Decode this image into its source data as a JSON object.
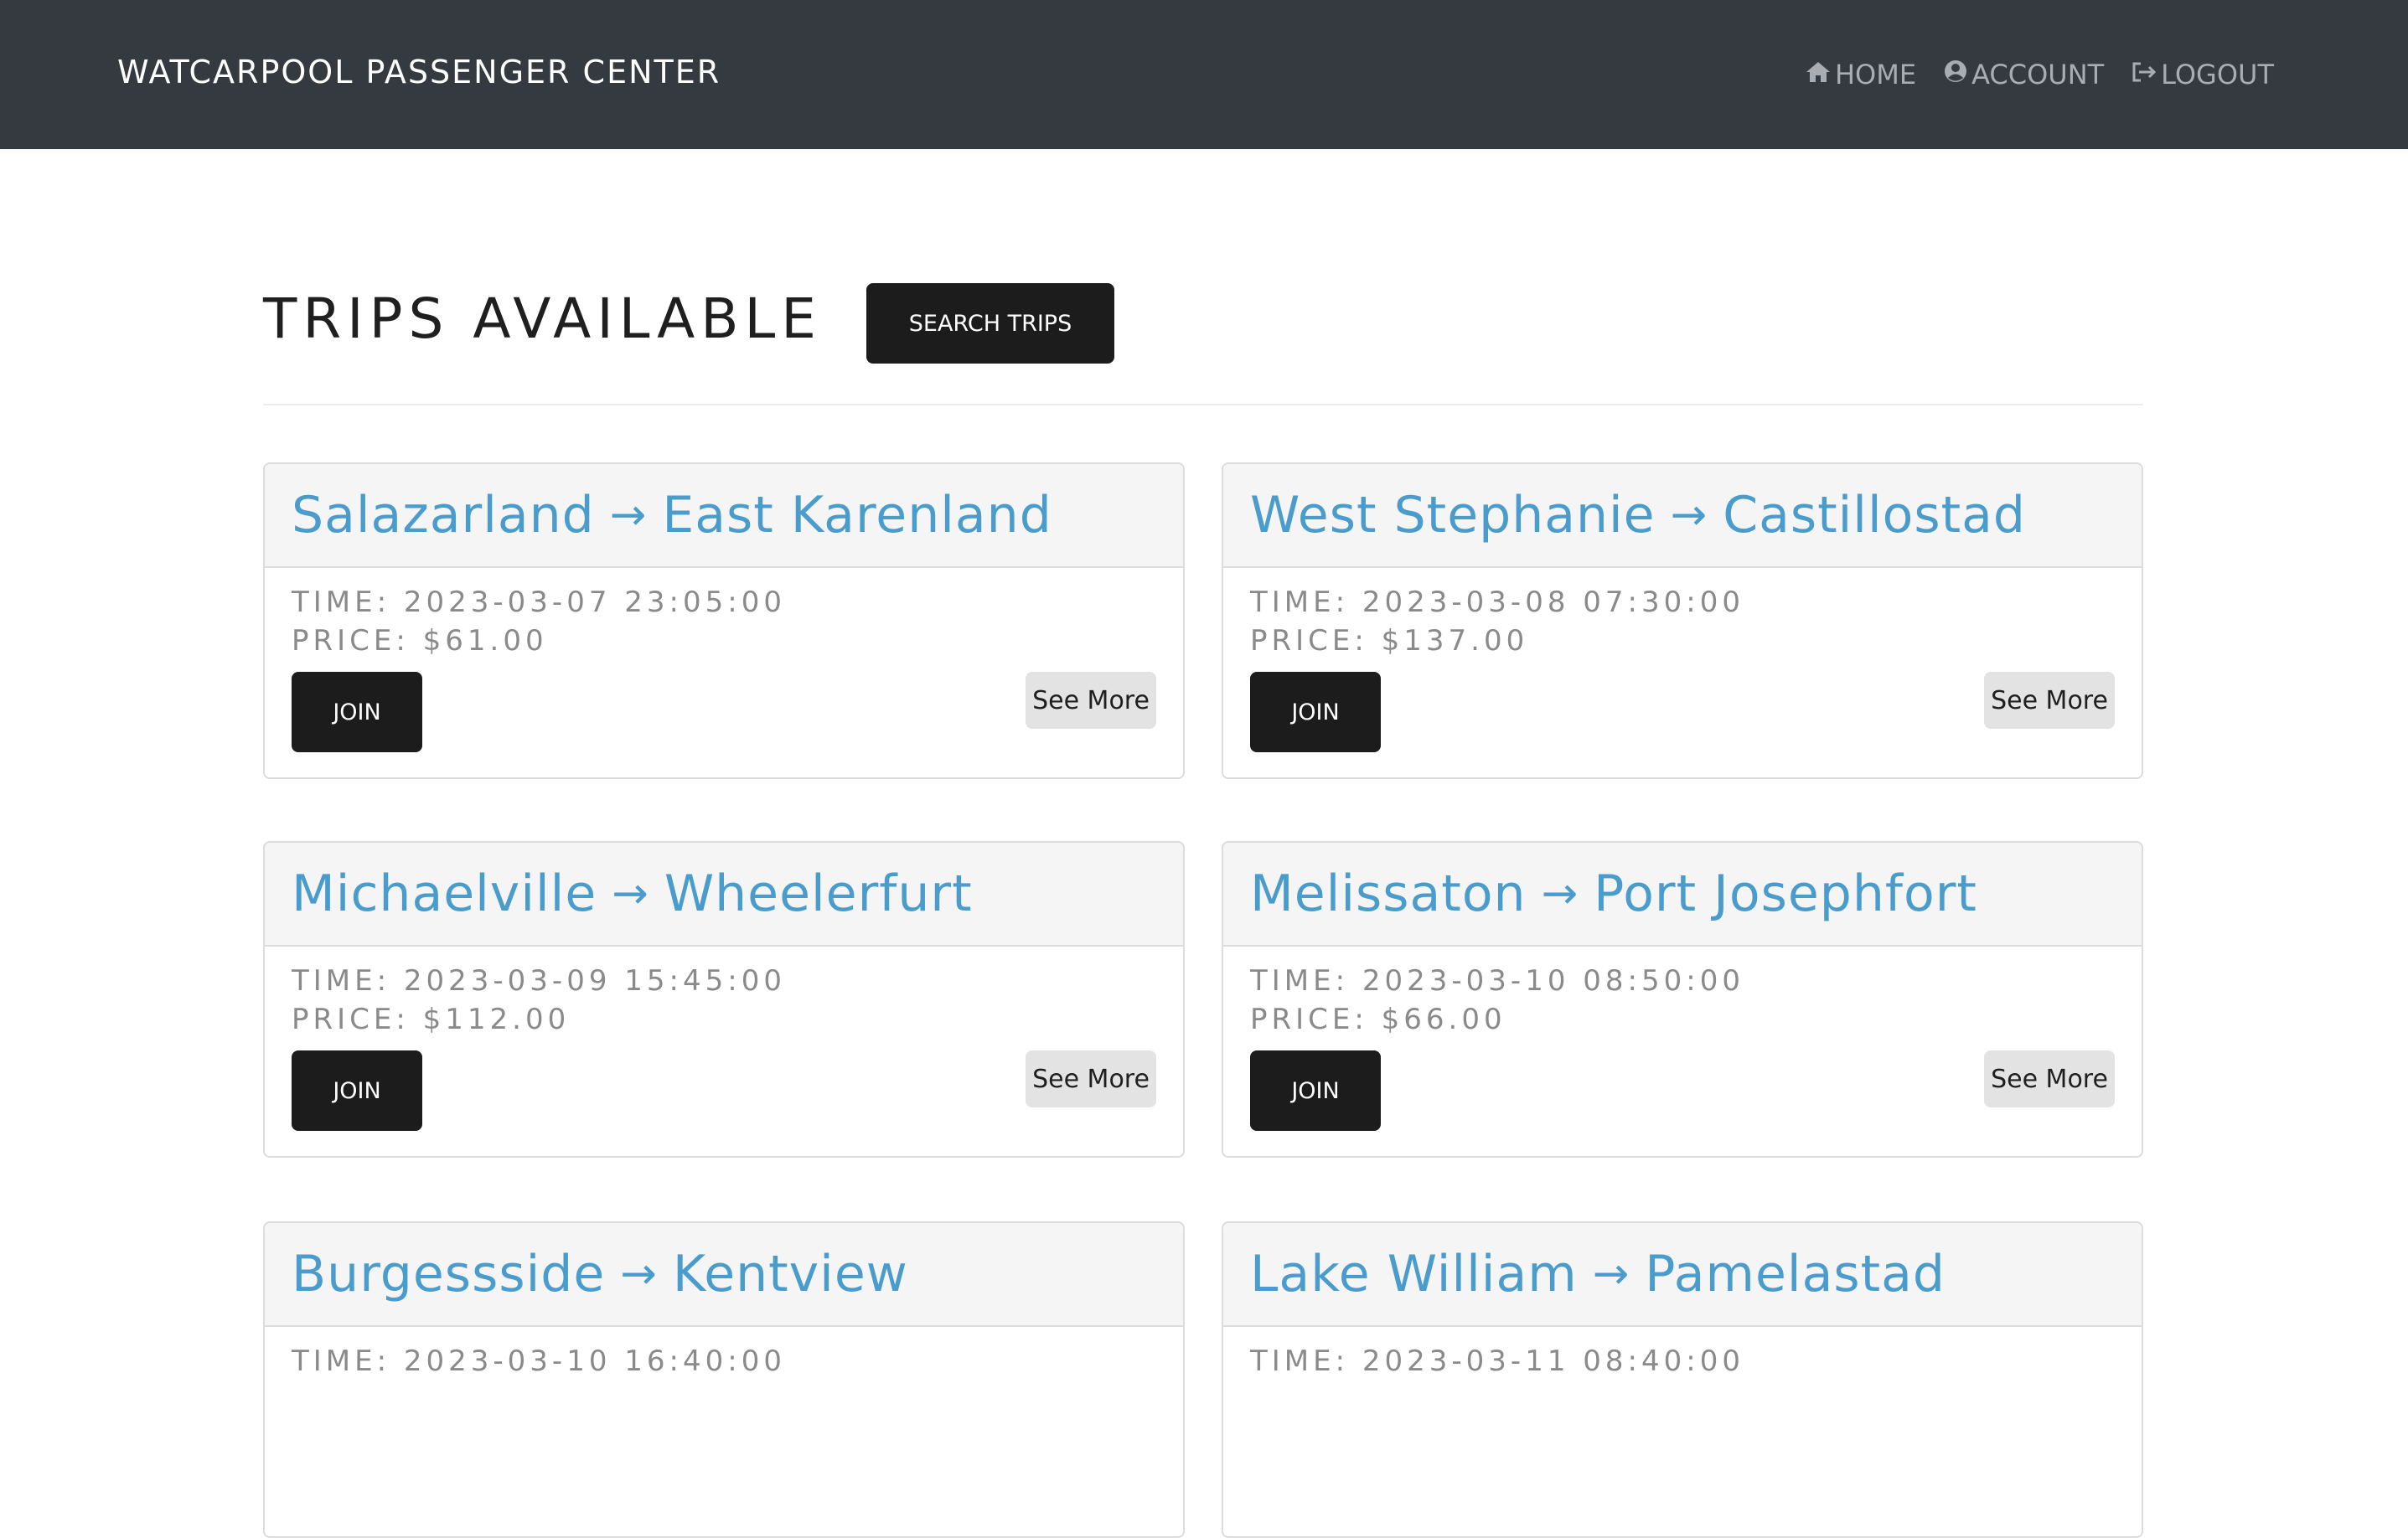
{
  "nav": {
    "brand": "WATCARPOOL PASSENGER CENTER",
    "home": "HOME",
    "account": "ACCOUNT",
    "logout": "LOGOUT"
  },
  "main": {
    "title": "TRIPS AVAILABLE",
    "search_label": "SEARCH TRIPS"
  },
  "arrow_glyph": "→",
  "trips": [
    {
      "from": "Salazarland",
      "to": "East Karenland",
      "time": "TIME: 2023-03-07 23:05:00",
      "price": "PRICE: $61.00",
      "join": "JOIN",
      "more": "See More"
    },
    {
      "from": "West Stephanie",
      "to": "Castillostad",
      "time": "TIME: 2023-03-08 07:30:00",
      "price": "PRICE: $137.00",
      "join": "JOIN",
      "more": "See More"
    },
    {
      "from": "Michaelville",
      "to": "Wheelerfurt",
      "time": "TIME: 2023-03-09 15:45:00",
      "price": "PRICE: $112.00",
      "join": "JOIN",
      "more": "See More"
    },
    {
      "from": "Melissaton",
      "to": "Port Josephfort",
      "time": "TIME: 2023-03-10 08:50:00",
      "price": "PRICE: $66.00",
      "join": "JOIN",
      "more": "See More"
    },
    {
      "from": "Burgessside",
      "to": "Kentview",
      "time": "TIME: 2023-03-10 16:40:00",
      "price": "",
      "join": "",
      "more": ""
    },
    {
      "from": "Lake William",
      "to": "Pamelastad",
      "time": "TIME: 2023-03-11 08:40:00",
      "price": "",
      "join": "",
      "more": ""
    }
  ]
}
